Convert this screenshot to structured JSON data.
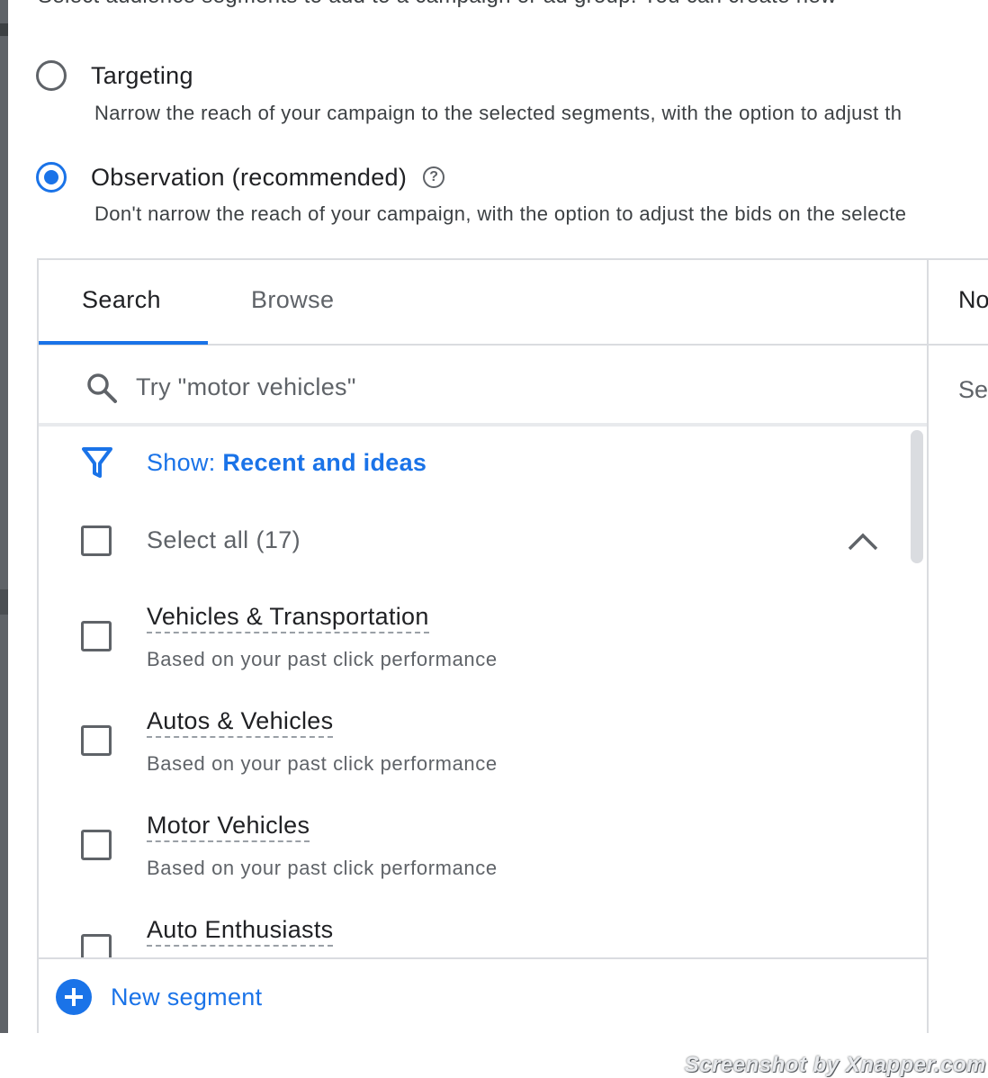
{
  "page": {
    "intro_text": "Select audience segments to add to a campaign or ad group. You can create new"
  },
  "targeting_options": [
    {
      "label": "Targeting",
      "description": "Narrow the reach of your campaign to the selected segments, with the option to adjust th",
      "selected": false
    },
    {
      "label": "Observation (recommended)",
      "description": "Don't narrow the reach of your campaign, with the option to adjust the bids on the selecte",
      "selected": true
    }
  ],
  "tabs": [
    {
      "label": "Search",
      "active": true
    },
    {
      "label": "Browse",
      "active": false
    }
  ],
  "right_panel": {
    "header_text": "No",
    "sub_text": "Se"
  },
  "search": {
    "placeholder": "Try \"motor vehicles\""
  },
  "filter": {
    "prefix": "Show: ",
    "value": "Recent and ideas"
  },
  "select_all": {
    "label": "Select all (17)"
  },
  "segments": [
    {
      "title": "Vehicles & Transportation",
      "subtitle": "Based on your past click performance",
      "checked": false
    },
    {
      "title": "Autos & Vehicles",
      "subtitle": "Based on your past click performance",
      "checked": false
    },
    {
      "title": "Motor Vehicles",
      "subtitle": "Based on your past click performance",
      "checked": false
    },
    {
      "title": "Auto Enthusiasts",
      "subtitle": "",
      "checked": false
    }
  ],
  "footer": {
    "new_segment_label": "New segment"
  },
  "watermark": "Screenshot by Xnapper.com",
  "colors": {
    "accent": "#1a73e8",
    "text_primary": "#202124",
    "text_secondary": "#5f6368",
    "divider": "#dadce0"
  },
  "icons": [
    "help-icon",
    "search-icon",
    "filter-icon",
    "chevron-up-icon",
    "plus-icon"
  ]
}
